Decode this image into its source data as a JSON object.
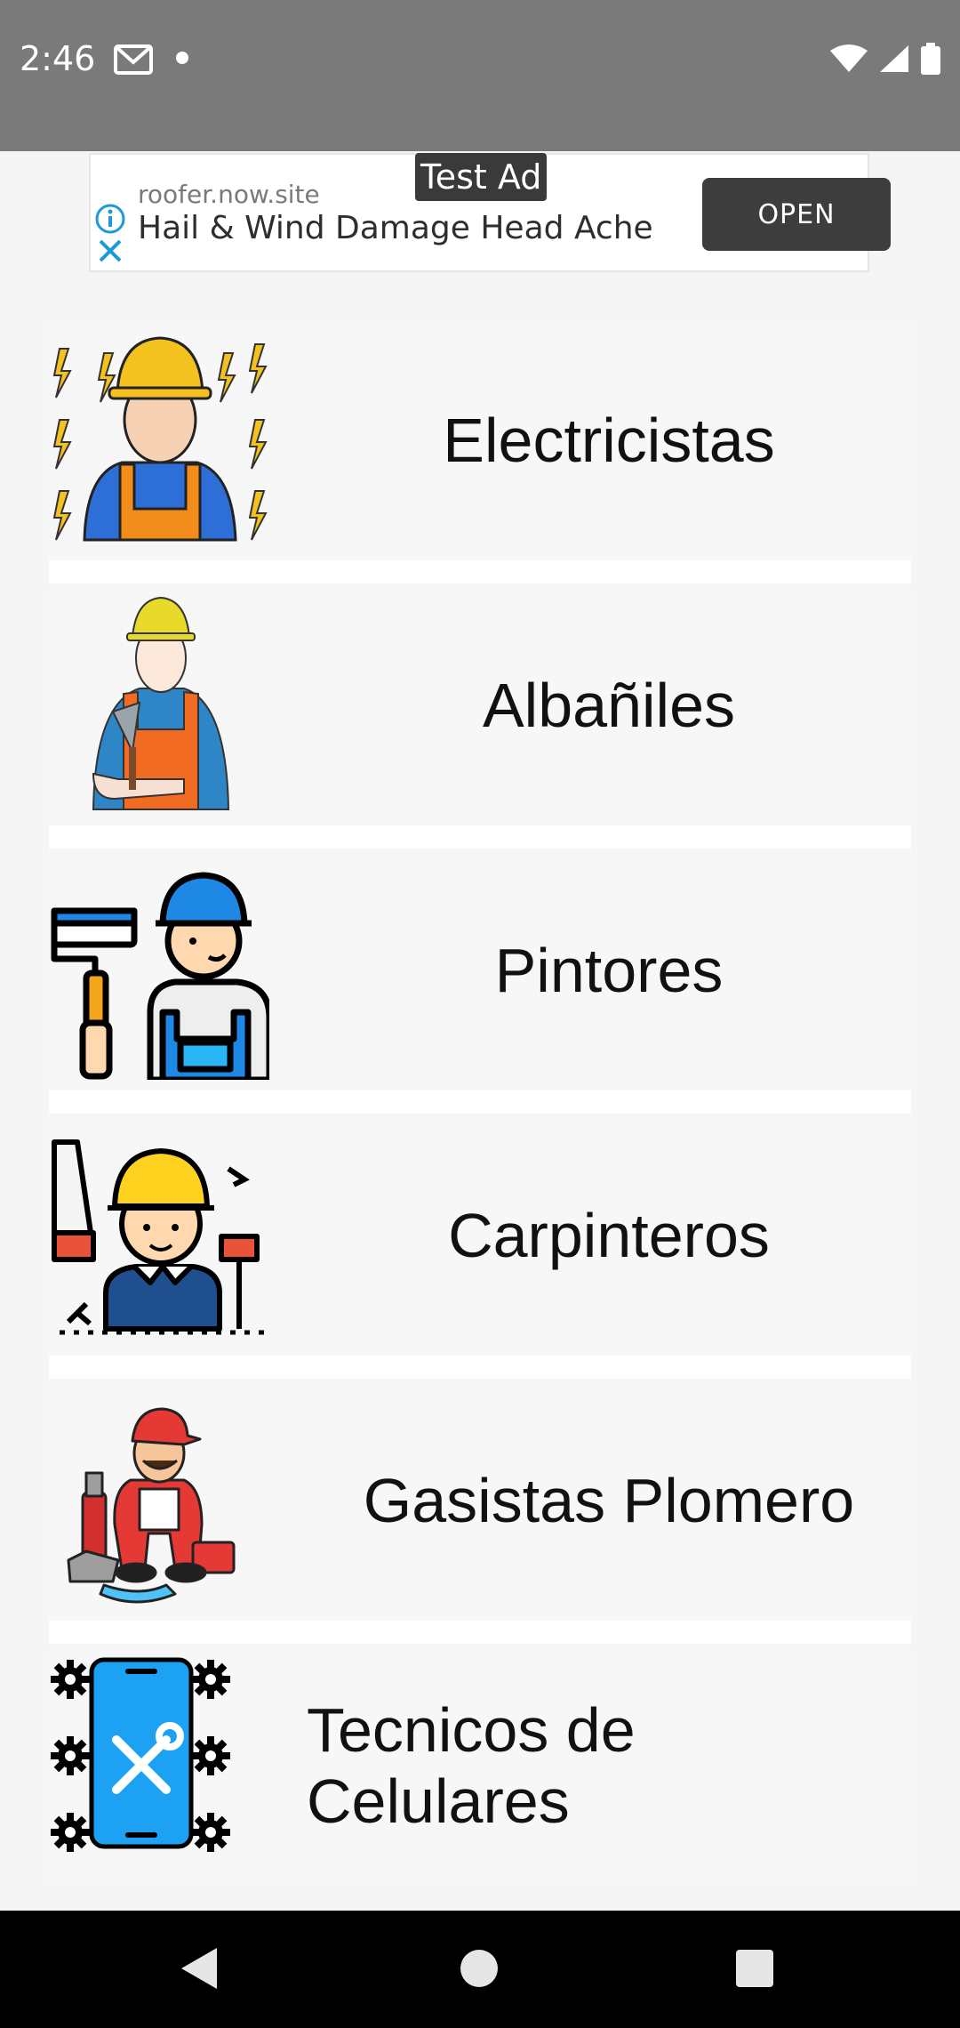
{
  "status_bar": {
    "time": "2:46"
  },
  "ad": {
    "tag": "Test Ad",
    "site": "roofer.now.site",
    "headline": "Hail & Wind Damage Head Ache",
    "open_label": "OPEN"
  },
  "categories": [
    {
      "label": "Electricistas",
      "icon": "electrician-icon"
    },
    {
      "label": "Albañiles",
      "icon": "mason-icon"
    },
    {
      "label": "Pintores",
      "icon": "painter-icon"
    },
    {
      "label": "Carpinteros",
      "icon": "carpenter-icon"
    },
    {
      "label": "Gasistas Plomero",
      "icon": "plumber-icon"
    },
    {
      "label": "Tecnicos de Celulares",
      "icon": "phone-repair-icon"
    }
  ],
  "colors": {
    "status_bar": "#7a7a7a",
    "ad_button": "#3d3d3d",
    "background": "#f5f5f5",
    "phone_blue": "#1da1f2",
    "helmet_yellow": "#f4c21f"
  }
}
